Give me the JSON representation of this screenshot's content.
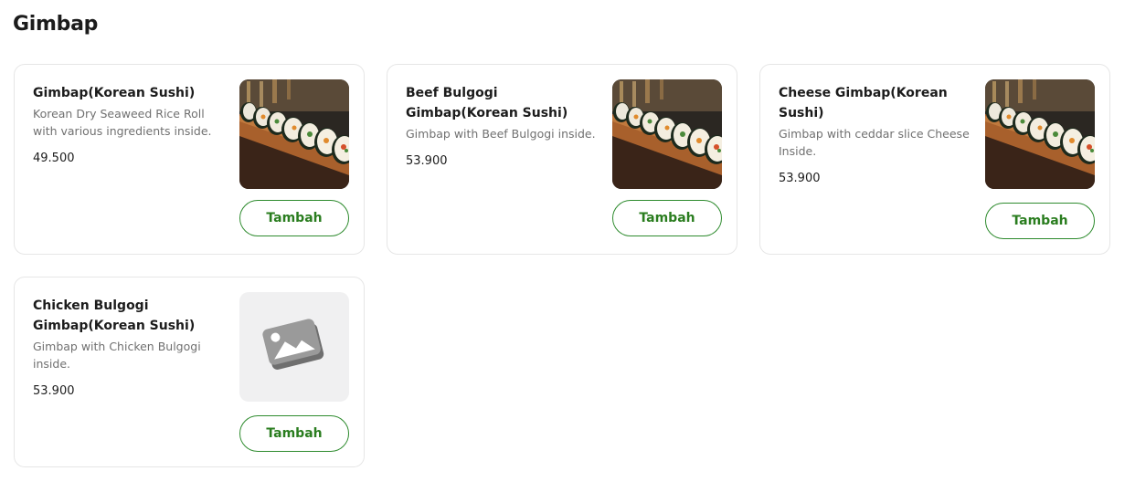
{
  "section": {
    "title": "Gimbap"
  },
  "accent_color": "#2a7d1f",
  "placeholder_icon": "image-placeholder-icon",
  "items": [
    {
      "name": "Gimbap(Korean Sushi)",
      "description": "Korean Dry Seaweed Rice Roll with various ingredients inside.",
      "price": "49.500",
      "button_label": "Tambah",
      "has_image": true
    },
    {
      "name": "Beef Bulgogi Gimbap(Korean Sushi)",
      "description": "Gimbap with Beef Bulgogi inside.",
      "price": "53.900",
      "button_label": "Tambah",
      "has_image": true
    },
    {
      "name": "Cheese Gimbap(Korean Sushi)",
      "description": "Gimbap with ceddar slice Cheese Inside.",
      "price": "53.900",
      "button_label": "Tambah",
      "has_image": true
    },
    {
      "name": "Chicken Bulgogi Gimbap(Korean Sushi)",
      "description": "Gimbap with Chicken Bulgogi inside.",
      "price": "53.900",
      "button_label": "Tambah",
      "has_image": false
    }
  ]
}
